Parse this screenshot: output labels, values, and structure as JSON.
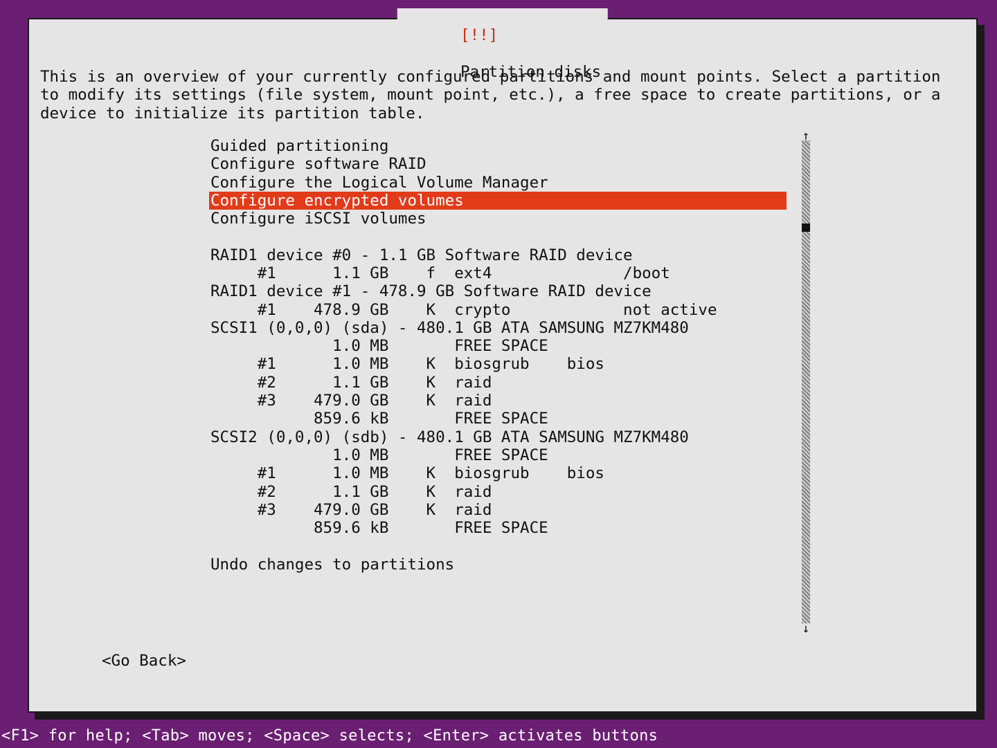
{
  "window_title": {
    "bang": "[!!]",
    "text": "Partition disks"
  },
  "description": "This is an overview of your currently configured partitions and mount points. Select a partition to modify its settings (file system, mount point, etc.), a free space to create partitions, or a device to initialize its partition table.",
  "menu": {
    "selected_index": 3,
    "top_items": [
      "Guided partitioning",
      "Configure software RAID",
      "Configure the Logical Volume Manager",
      "Configure encrypted volumes",
      "Configure iSCSI volumes"
    ],
    "device_lines": [
      "RAID1 device #0 - 1.1 GB Software RAID device",
      "     #1      1.1 GB    f  ext4              /boot",
      "RAID1 device #1 - 478.9 GB Software RAID device",
      "     #1    478.9 GB    K  crypto            not active",
      "SCSI1 (0,0,0) (sda) - 480.1 GB ATA SAMSUNG MZ7KM480",
      "             1.0 MB       FREE SPACE",
      "     #1      1.0 MB    K  biosgrub    bios",
      "     #2      1.1 GB    K  raid",
      "     #3    479.0 GB    K  raid",
      "           859.6 kB       FREE SPACE",
      "SCSI2 (0,0,0) (sdb) - 480.1 GB ATA SAMSUNG MZ7KM480",
      "             1.0 MB       FREE SPACE",
      "     #1      1.0 MB    K  biosgrub    bios",
      "     #2      1.1 GB    K  raid",
      "     #3    479.0 GB    K  raid",
      "           859.6 kB       FREE SPACE"
    ],
    "bottom_items": [
      "Undo changes to partitions"
    ]
  },
  "go_back": "<Go Back>",
  "footer": "<F1> for help; <Tab> moves; <Space> selects; <Enter> activates buttons"
}
